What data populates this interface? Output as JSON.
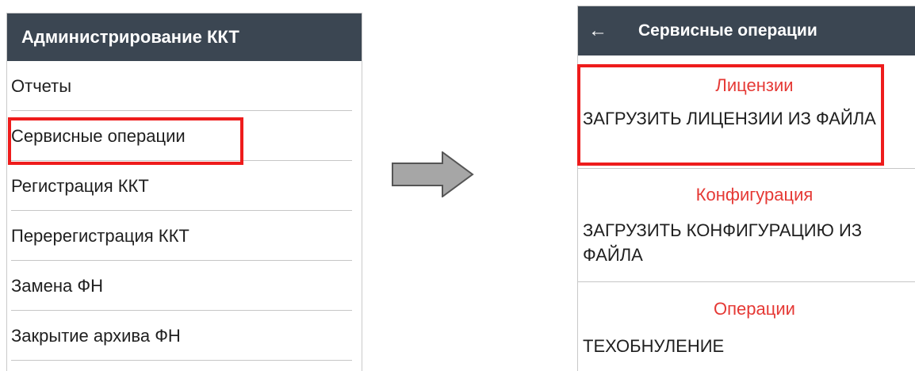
{
  "left_screen": {
    "title": "Администрирование ККТ",
    "menu": [
      "Отчеты",
      "Сервисные операции",
      "Регистрация ККТ",
      "Перерегистрация ККТ",
      "Замена ФН",
      "Закрытие архива ФН"
    ],
    "highlighted_item": "Сервисные операции"
  },
  "right_screen": {
    "title": "Сервисные операции",
    "back_icon": "arrow-left-icon",
    "sections": [
      {
        "header": "Лицензии",
        "action": "ЗАГРУЗИТЬ ЛИЦЕНЗИИ ИЗ ФАЙЛА"
      },
      {
        "header": "Конфигурация",
        "action": "ЗАГРУЗИТЬ КОНФИГУРАЦИЮ ИЗ ФАЙЛА"
      },
      {
        "header": "Операции",
        "action": "ТЕХОБНУЛЕНИЕ"
      }
    ],
    "highlighted_section": "Лицензии"
  },
  "transition_icon": "right-arrow-icon",
  "colors": {
    "appbar": "#3b4652",
    "section_header": "#e53935",
    "highlight": "#ee1c1c",
    "arrow_fill": "#a6a6a6",
    "arrow_stroke": "#555555"
  }
}
